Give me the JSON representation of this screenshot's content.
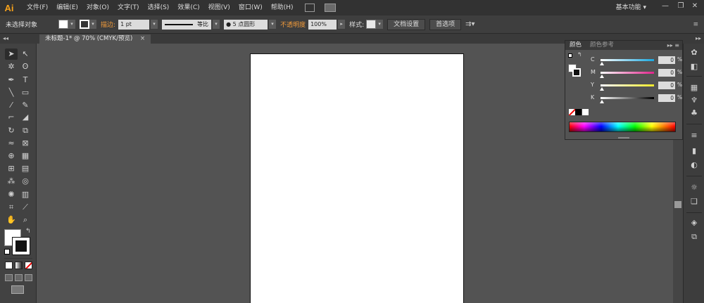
{
  "app": {
    "logo": "Ai"
  },
  "menu": [
    "文件(F)",
    "编辑(E)",
    "对象(O)",
    "文字(T)",
    "选择(S)",
    "效果(C)",
    "视图(V)",
    "窗口(W)",
    "帮助(H)"
  ],
  "workspace": {
    "label": "基本功能",
    "arrow": "▾"
  },
  "window_controls": {
    "minimize": "—",
    "restore": "❐",
    "close": "✕"
  },
  "control_bar": {
    "selection_label": "未选择对象",
    "stroke_label": "描边:",
    "stroke_weight": "1 pt",
    "stroke_profile": "等比",
    "brush": "● 5 点圆形",
    "opacity_label": "不透明度",
    "opacity_value": "100%",
    "style_label": "样式:",
    "doc_setup": "文档设置",
    "preferences": "首选项"
  },
  "document_tab": {
    "title": "未标题-1* @ 70% (CMYK/预览)",
    "close": "×"
  },
  "color_panel": {
    "tab_color": "颜色",
    "tab_guide": "颜色参考",
    "channels": [
      {
        "name": "C",
        "value": "0",
        "color": "#1aa8e0"
      },
      {
        "name": "M",
        "value": "0",
        "color": "#e2238c"
      },
      {
        "name": "Y",
        "value": "0",
        "color": "#f4ea2a"
      },
      {
        "name": "K",
        "value": "0",
        "color": "#888888"
      }
    ],
    "percent": "%"
  },
  "colors": {
    "menubar": "#323232",
    "accent": "#f7a21b",
    "canvas": "#535353",
    "artboard": "#ffffff"
  }
}
